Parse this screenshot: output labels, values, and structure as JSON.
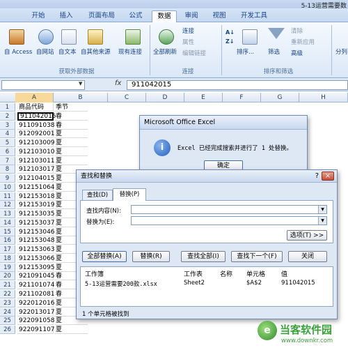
{
  "window": {
    "file_title": "5-13运营需要数"
  },
  "ribbon": {
    "tabs": [
      "开始",
      "插入",
      "页面布局",
      "公式",
      "数据",
      "审阅",
      "视图",
      "开发工具"
    ],
    "active_tab": "数据",
    "group_external": {
      "label": "获取外部数据",
      "buttons": [
        "自 Access",
        "自网站",
        "自文本",
        "自其他来源",
        "现有连接"
      ]
    },
    "group_connections": {
      "label": "连接",
      "refresh": "全部刷新",
      "small": [
        "连接",
        "属性",
        "编辑链接"
      ]
    },
    "group_sort": {
      "label": "排序和筛选",
      "sort": "排序...",
      "filter": "筛选",
      "small": [
        "清除",
        "重新应用",
        "高级"
      ]
    },
    "cut_off_button": "分列"
  },
  "formula_bar": {
    "fx": "fx",
    "value": "911042015"
  },
  "grid": {
    "columns": [
      "A",
      "B",
      "C",
      "D",
      "E",
      "F",
      "G",
      "H"
    ],
    "rows": [
      {
        "n": "1",
        "a": "商品代码",
        "b": "季节"
      },
      {
        "n": "2",
        "a": "911042015",
        "b": "春"
      },
      {
        "n": "3",
        "a": "911091038",
        "b": "春"
      },
      {
        "n": "4",
        "a": "912092001",
        "b": "夏"
      },
      {
        "n": "5",
        "a": "912103009",
        "b": "夏"
      },
      {
        "n": "6",
        "a": "912103010",
        "b": "夏"
      },
      {
        "n": "7",
        "a": "912103011",
        "b": "夏"
      },
      {
        "n": "8",
        "a": "912103017",
        "b": "夏"
      },
      {
        "n": "9",
        "a": "912104015",
        "b": "夏"
      },
      {
        "n": "10",
        "a": "912151064",
        "b": "夏"
      },
      {
        "n": "11",
        "a": "912153018",
        "b": "夏"
      },
      {
        "n": "12",
        "a": "912153019",
        "b": "夏"
      },
      {
        "n": "13",
        "a": "912153035",
        "b": "夏"
      },
      {
        "n": "14",
        "a": "912153037",
        "b": "夏"
      },
      {
        "n": "15",
        "a": "912153046",
        "b": "夏"
      },
      {
        "n": "16",
        "a": "912153048",
        "b": "夏"
      },
      {
        "n": "17",
        "a": "912153063",
        "b": "夏"
      },
      {
        "n": "18",
        "a": "912153066",
        "b": "夏"
      },
      {
        "n": "19",
        "a": "912153095",
        "b": "夏"
      },
      {
        "n": "20",
        "a": "921091045",
        "b": "春"
      },
      {
        "n": "21",
        "a": "921101074",
        "b": "春"
      },
      {
        "n": "22",
        "a": "921102081",
        "b": "春"
      },
      {
        "n": "23",
        "a": "922012016",
        "b": "夏"
      },
      {
        "n": "24",
        "a": "922013017",
        "b": "夏"
      },
      {
        "n": "25",
        "a": "922091058",
        "b": "夏"
      },
      {
        "n": "26",
        "a": "922091107",
        "b": "夏"
      }
    ]
  },
  "message_box": {
    "title": "Microsoft Office Excel",
    "message": "Excel 已经完成搜索并进行了 1 处替换。",
    "ok": "确定"
  },
  "find_replace": {
    "title": "查找和替换",
    "help": "?",
    "close_x": "×",
    "tab_find": "查找(D)",
    "tab_replace": "替换(P)",
    "find_label": "查找内容(N):",
    "replace_label": "替换为(E):",
    "options": "选项(T) >>",
    "btn_replace_all": "全部替换(A)",
    "btn_replace": "替换(R)",
    "btn_find_all": "查找全部(I)",
    "btn_find_next": "查找下一个(F)",
    "btn_close": "关闭",
    "results_headers": [
      "工作簿",
      "工作表",
      "名称",
      "单元格",
      "值"
    ],
    "result": {
      "workbook": "5-13运营需要200款.xlsx",
      "sheet": "Sheet2",
      "name": "",
      "cell": "$A$2",
      "value": "911042015"
    },
    "status": "1 个单元格被找到"
  },
  "watermark": {
    "brand": "当客软件园",
    "url": "www.downkr.com"
  },
  "colors": {
    "ribbon_blue": "#15428b",
    "dialog_bg": "#dee7f4",
    "info_icon": "#1f5fbf",
    "watermark_green": "#3aa23a"
  }
}
